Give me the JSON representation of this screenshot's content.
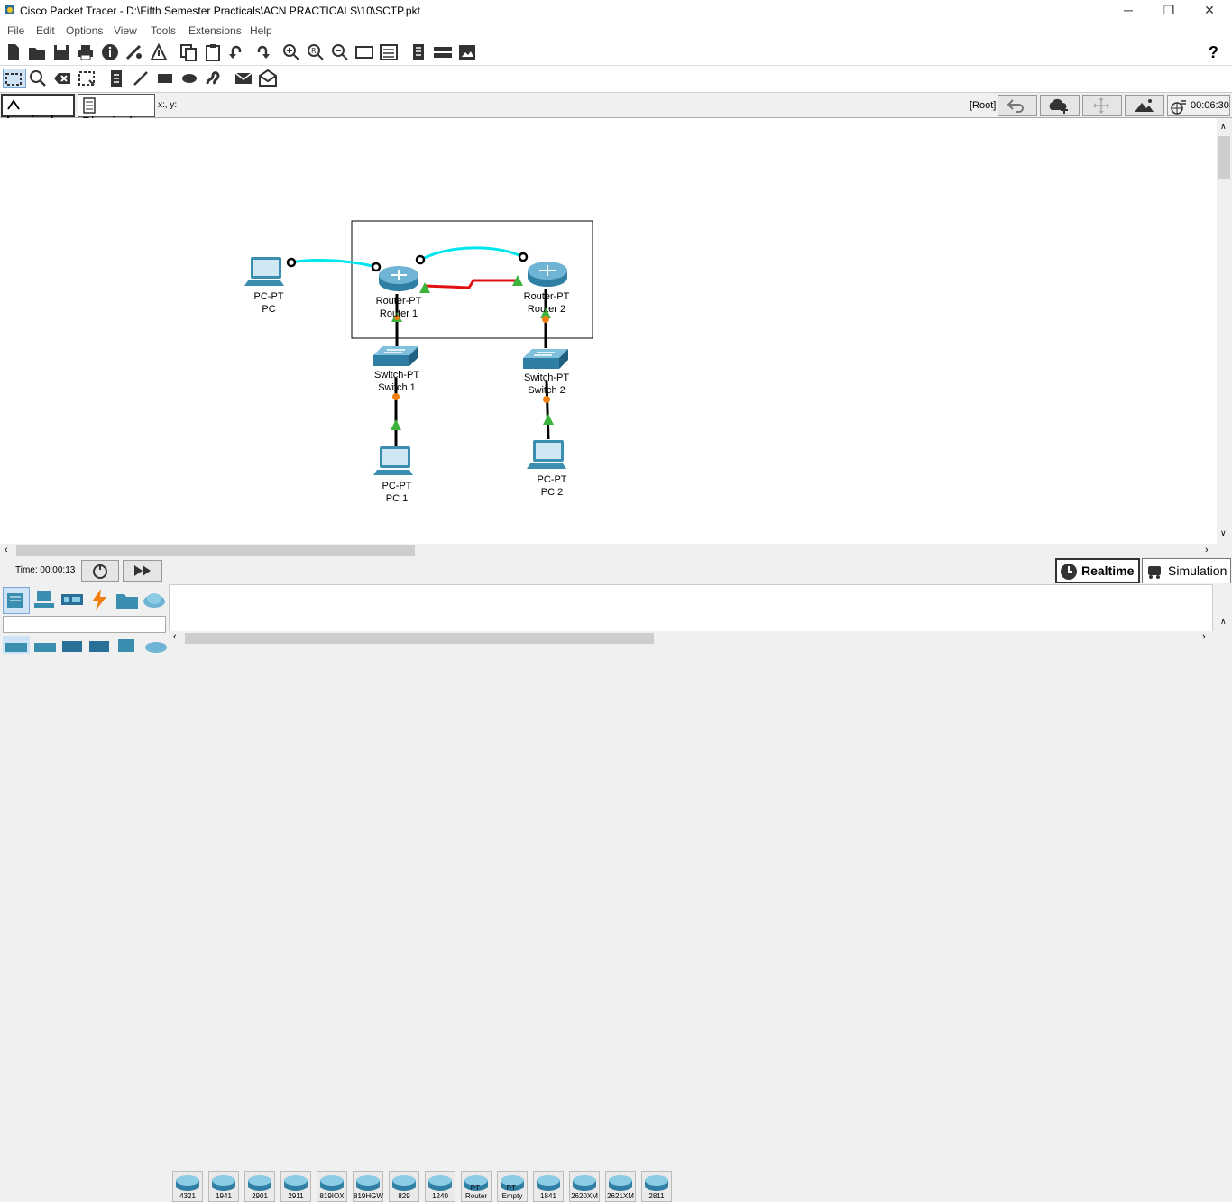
{
  "window": {
    "title": "Cisco Packet Tracer - D:\\Fifth Semester Practicals\\ACN PRACTICALS\\10\\SCTP.pkt",
    "minimize": "─",
    "restore": "❐",
    "close": "✕"
  },
  "menu": [
    "File",
    "Edit",
    "Options",
    "View",
    "Tools",
    "Extensions",
    "Help"
  ],
  "help_icon": "?",
  "view": {
    "logical_label": "Logical",
    "physical_label": "Physical",
    "coords_label": "x:, y:",
    "root_label": "[Root]",
    "clock": "00:06:30"
  },
  "devices": [
    {
      "type": "PC-PT",
      "name": "PC"
    },
    {
      "type": "Router-PT",
      "name": "Router 1"
    },
    {
      "type": "Router-PT",
      "name": "Router 2"
    },
    {
      "type": "Switch-PT",
      "name": "Switch 1"
    },
    {
      "type": "Switch-PT",
      "name": "Switch 2"
    },
    {
      "type": "PC-PT",
      "name": "PC 1"
    },
    {
      "type": "PC-PT",
      "name": "PC 2"
    }
  ],
  "timebar": {
    "time_label": "Time: 00:00:13",
    "realtime_label": "Realtime",
    "simulation_label": "Simulation"
  },
  "device_models": [
    "4321",
    "1941",
    "2901",
    "2911",
    "819IOX",
    "819HGW",
    "829",
    "1240",
    "PT-Router",
    "PT-Empty",
    "1841",
    "2620XM",
    "2621XM",
    "2811"
  ],
  "colors": {
    "cross_cable": "#00e5ee",
    "serial_cable": "#e01010",
    "link_up": "#3cb43c",
    "link_amber": "#f07f10",
    "device_blue": "#3a8fb0"
  }
}
